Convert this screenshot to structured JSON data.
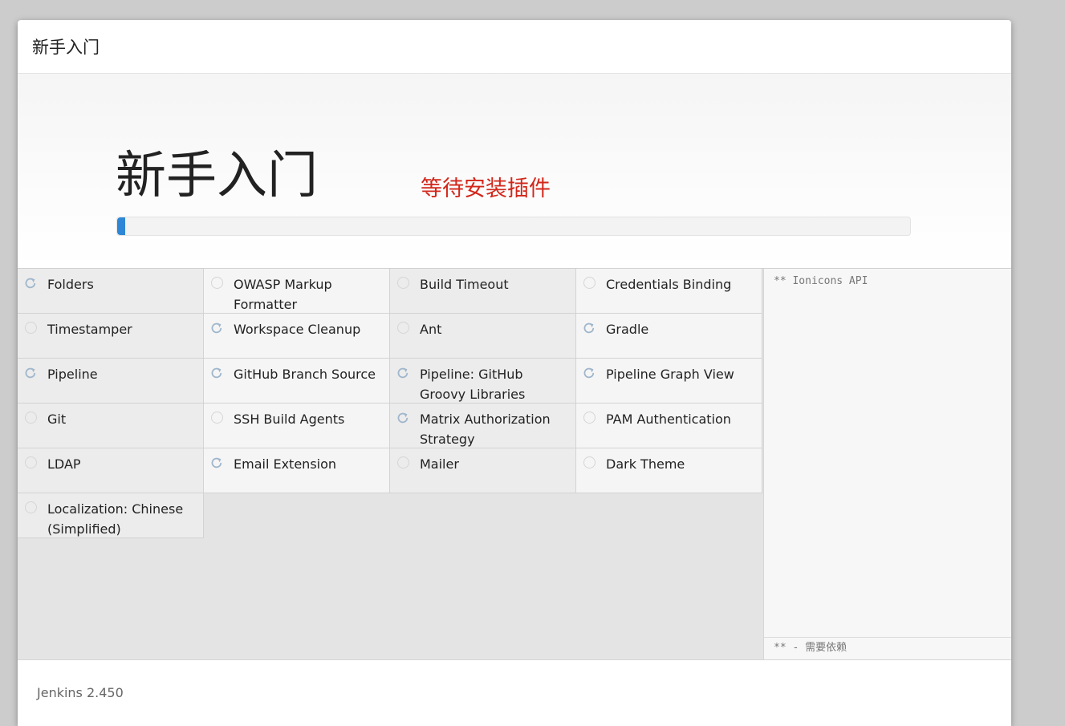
{
  "header": {
    "title": "新手入门"
  },
  "hero": {
    "title": "新手入门",
    "status": "等待安装插件",
    "progress": 0.01
  },
  "colors": {
    "status_text": "#d2271b",
    "progress_fill": "#2e86d6"
  },
  "plugins": [
    {
      "name": "Folders",
      "state": "installing"
    },
    {
      "name": "OWASP Markup Formatter",
      "state": "pending"
    },
    {
      "name": "Build Timeout",
      "state": "pending"
    },
    {
      "name": "Credentials Binding",
      "state": "pending"
    },
    {
      "name": "Timestamper",
      "state": "pending"
    },
    {
      "name": "Workspace Cleanup",
      "state": "installing"
    },
    {
      "name": "Ant",
      "state": "pending"
    },
    {
      "name": "Gradle",
      "state": "installing"
    },
    {
      "name": "Pipeline",
      "state": "installing"
    },
    {
      "name": "GitHub Branch Source",
      "state": "installing"
    },
    {
      "name": "Pipeline: GitHub Groovy Libraries",
      "state": "installing"
    },
    {
      "name": "Pipeline Graph View",
      "state": "installing"
    },
    {
      "name": "Git",
      "state": "pending"
    },
    {
      "name": "SSH Build Agents",
      "state": "pending"
    },
    {
      "name": "Matrix Authorization Strategy",
      "state": "installing"
    },
    {
      "name": "PAM Authentication",
      "state": "pending"
    },
    {
      "name": "LDAP",
      "state": "pending"
    },
    {
      "name": "Email Extension",
      "state": "installing"
    },
    {
      "name": "Mailer",
      "state": "pending"
    },
    {
      "name": "Dark Theme",
      "state": "pending"
    },
    {
      "name": "Localization: Chinese (Simplified)",
      "state": "pending"
    }
  ],
  "log": {
    "line": "** Ionicons API",
    "footer": "** - 需要依赖"
  },
  "footer": {
    "version": "Jenkins 2.450"
  },
  "icons": {
    "installing": "refresh-icon",
    "pending": "empty-circle-icon"
  }
}
